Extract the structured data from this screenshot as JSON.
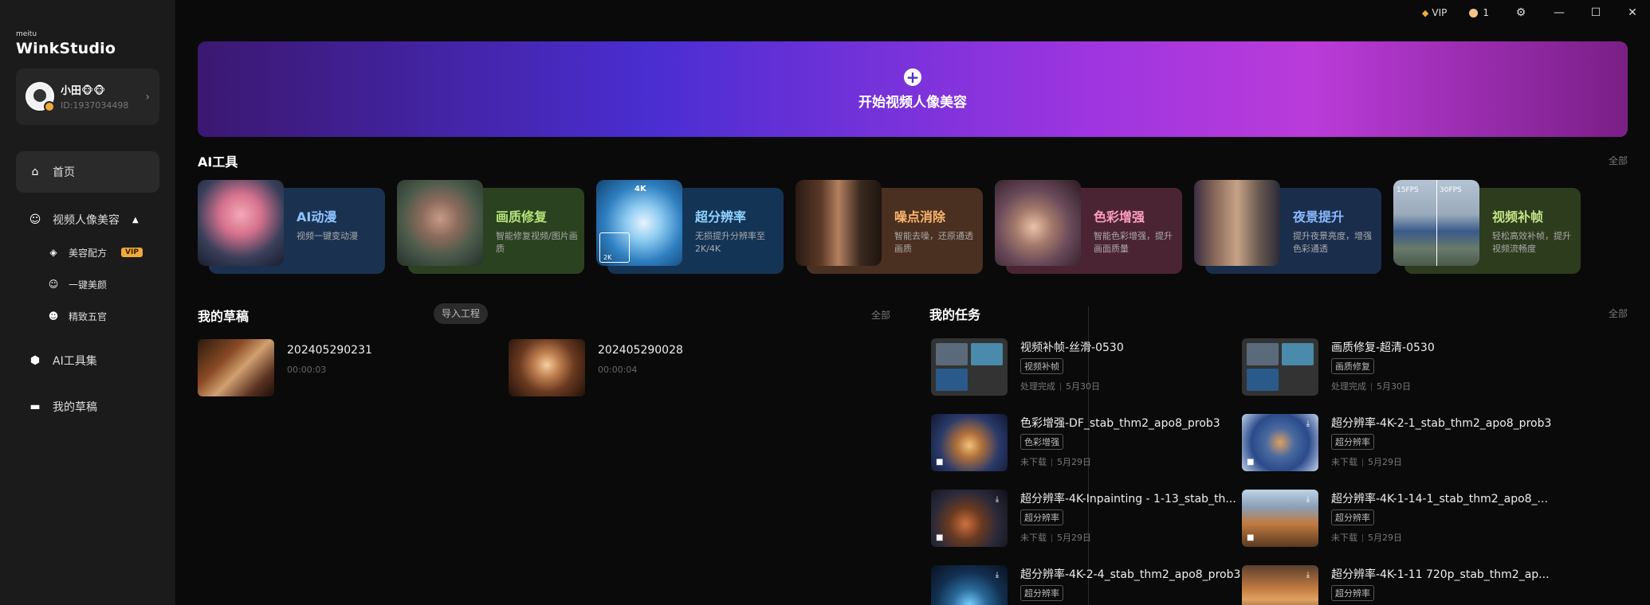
{
  "app": {
    "logo_small": "meitu",
    "logo": "WinkStudio"
  },
  "user": {
    "name": "小田🐵🐵",
    "id": "ID:1937034498"
  },
  "sidebar": {
    "home": "首页",
    "portrait": "视频人像美容",
    "sub": [
      {
        "label": "美容配方",
        "badge": "VIP"
      },
      {
        "label": "一键美颜"
      },
      {
        "label": "精致五官"
      }
    ],
    "ai_tools": "AI工具集",
    "drafts": "我的草稿"
  },
  "titlebar": {
    "vip": "VIP",
    "coins": "1"
  },
  "banner": {
    "text": "开始视频人像美容"
  },
  "ai_tools": {
    "title": "AI工具",
    "all": "全部",
    "items": [
      {
        "name": "AI动漫",
        "desc": "视频一键变动漫",
        "color": "#1a3250",
        "name_color": "#8fc3ff"
      },
      {
        "name": "画质修复",
        "desc": "智能修复视频/图片画质",
        "color": "#2a4220",
        "name_color": "#b7e37a"
      },
      {
        "name": "超分辨率",
        "desc": "无损提升分辨率至2K/4K",
        "color": "#143456",
        "name_color": "#8fd2ff",
        "thumb_labels": [
          "4K",
          "2K"
        ]
      },
      {
        "name": "噪点消除",
        "desc": "智能去噪，还原通透画质",
        "color": "#4a3020",
        "name_color": "#ffb66e"
      },
      {
        "name": "色彩增强",
        "desc": "智能色彩增强，提升画面质量",
        "color": "#4b2434",
        "name_color": "#ff9ebf"
      },
      {
        "name": "夜景提升",
        "desc": "提升夜景亮度，增强色彩通透",
        "color": "#1a2e4c",
        "name_color": "#8ab8ff"
      },
      {
        "name": "视频补帧",
        "desc": "轻松高效补帧，提升视频流畅度",
        "color": "#2e3c1e",
        "name_color": "#c3e386",
        "thumb_labels": [
          "15FPS",
          "30FPS"
        ]
      }
    ]
  },
  "drafts": {
    "title": "我的草稿",
    "import": "导入工程",
    "all": "全部",
    "items": [
      {
        "name": "202405290231",
        "duration": "00:00:03"
      },
      {
        "name": "202405290028",
        "duration": "00:00:04"
      }
    ]
  },
  "tasks": {
    "title": "我的任务",
    "all": "全部",
    "items": [
      {
        "title": "视频补帧-丝滑-0530",
        "tag": "视频补帧",
        "status": "处理完成",
        "date": "5月30日"
      },
      {
        "title": "画质修复-超清-0530",
        "tag": "画质修复",
        "status": "处理完成",
        "date": "5月30日"
      },
      {
        "title": "色彩增强-DF_stab_thm2_apo8_prob3",
        "tag": "色彩增强",
        "status": "未下载",
        "date": "5月29日"
      },
      {
        "title": "超分辨率-4K-2-1_stab_thm2_apo8_prob3",
        "tag": "超分辨率",
        "status": "未下载",
        "date": "5月29日"
      },
      {
        "title": "超分辨率-4K-Inpainting - 1-13_stab_th...",
        "tag": "超分辨率",
        "status": "未下载",
        "date": "5月29日"
      },
      {
        "title": "超分辨率-4K-1-14-1_stab_thm2_apo8_...",
        "tag": "超分辨率",
        "status": "未下载",
        "date": "5月29日"
      },
      {
        "title": "超分辨率-4K-2-4_stab_thm2_apo8_prob3",
        "tag": "超分辨率",
        "status": "",
        "date": ""
      },
      {
        "title": "超分辨率-4K-1-11 720p_stab_thm2_ap...",
        "tag": "超分辨率",
        "status": "",
        "date": ""
      }
    ]
  }
}
